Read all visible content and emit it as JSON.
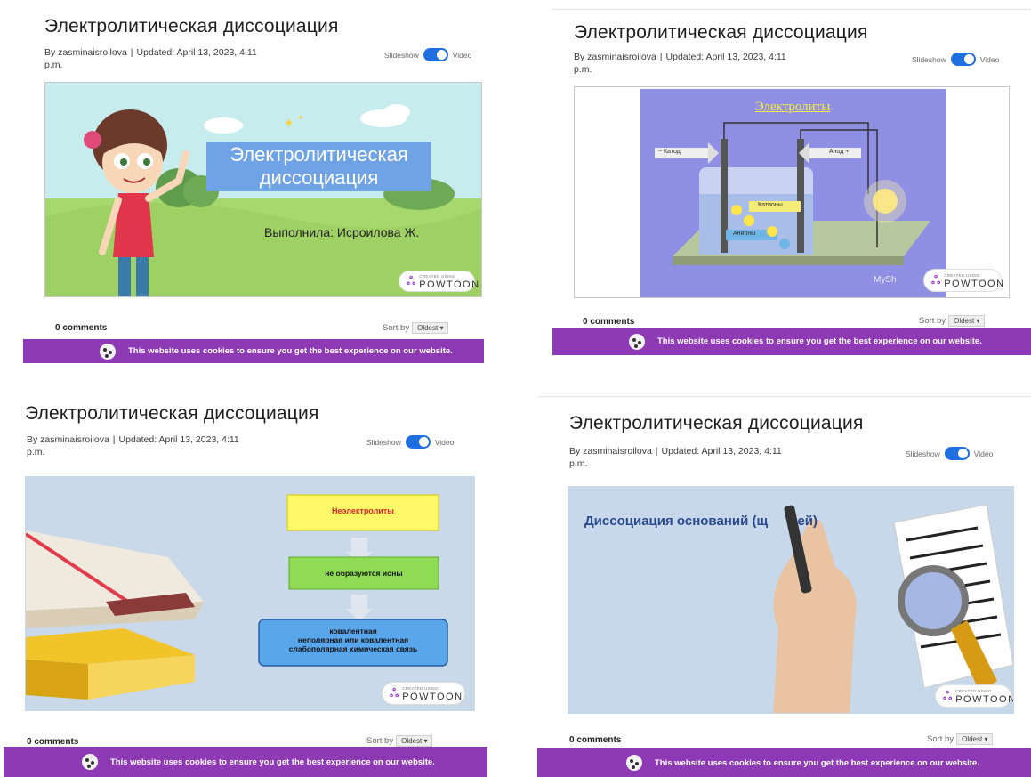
{
  "page": {
    "title": "Электролитическая диссоциация",
    "author": "By zasminaisroilova",
    "separator": "|",
    "updated": "Updated: April 13, 2023, 4:11",
    "updated_tail": "p.m.",
    "slideshow_label": "Slideshow",
    "video_label": "Video",
    "comments_count": "0 comments",
    "sort_label": "Sort by",
    "sort_value": "Oldest ▾",
    "cookie_text": "This website uses cookies to ensure you get the best experience on our website.",
    "powtoon_small": "CREATED USING",
    "powtoon_big": "POWTOON",
    "accent_color": "#8e3ab5",
    "toggle_color": "#1f6fe0"
  },
  "slide1": {
    "heading_line1": "Электролитическая",
    "heading_line2": "диссоциация",
    "performer": "Выполнила:  Исроилова Ж."
  },
  "slide2": {
    "heading": "Электролиты",
    "cathode": "− Катод",
    "anode": "Анод +",
    "cations": "Катионы",
    "anions": "Анионы",
    "watermark": "MySh"
  },
  "slide3": {
    "box1": "Неэлектролиты",
    "box2": "не образуются ионы",
    "box3_line1": "ковалентная",
    "box3_line2": "неполярная  или ковалентная",
    "box3_line3": "слабополярная химическая связь"
  },
  "slide4": {
    "heading": "Диссоциация оснований (щ        ей)"
  }
}
